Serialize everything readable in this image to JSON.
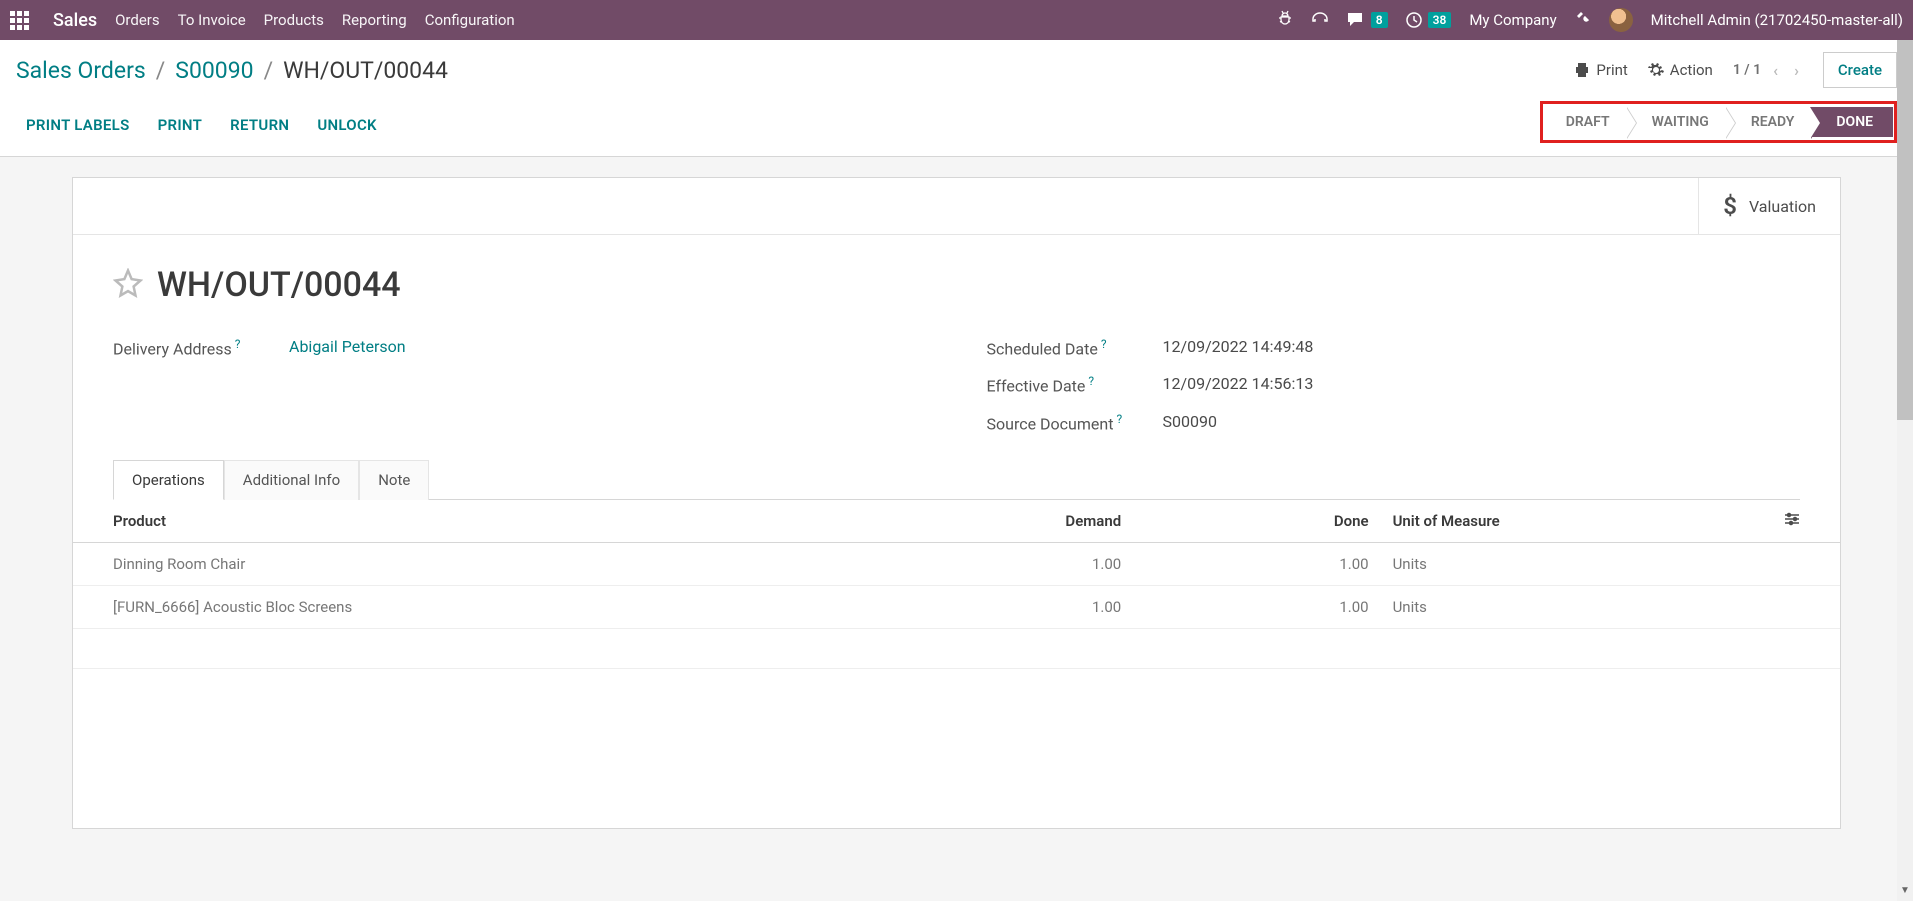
{
  "nav": {
    "brand": "Sales",
    "links": [
      "Orders",
      "To Invoice",
      "Products",
      "Reporting",
      "Configuration"
    ],
    "messages_badge": "8",
    "activities_badge": "38",
    "company": "My Company",
    "user": "Mitchell Admin (21702450-master-all)"
  },
  "breadcrumb": {
    "items": [
      "Sales Orders",
      "S00090"
    ],
    "current": "WH/OUT/00044"
  },
  "controls": {
    "print": "Print",
    "action": "Action",
    "pager": "1 / 1",
    "create": "Create"
  },
  "actions": [
    "PRINT LABELS",
    "PRINT",
    "RETURN",
    "UNLOCK"
  ],
  "status": {
    "draft": "DRAFT",
    "waiting": "WAITING",
    "ready": "READY",
    "done": "DONE"
  },
  "valuation": "Valuation",
  "record": {
    "title": "WH/OUT/00044",
    "delivery_address_label": "Delivery Address",
    "delivery_address": "Abigail Peterson",
    "scheduled_label": "Scheduled Date",
    "scheduled": "12/09/2022 14:49:48",
    "effective_label": "Effective Date",
    "effective": "12/09/2022 14:56:13",
    "source_label": "Source Document",
    "source": "S00090"
  },
  "tabs": [
    "Operations",
    "Additional Info",
    "Note"
  ],
  "table": {
    "headers": {
      "product": "Product",
      "demand": "Demand",
      "done": "Done",
      "uom": "Unit of Measure"
    },
    "rows": [
      {
        "product": "Dinning Room Chair",
        "demand": "1.00",
        "done": "1.00",
        "uom": "Units"
      },
      {
        "product": "[FURN_6666] Acoustic Bloc Screens",
        "demand": "1.00",
        "done": "1.00",
        "uom": "Units"
      }
    ]
  }
}
